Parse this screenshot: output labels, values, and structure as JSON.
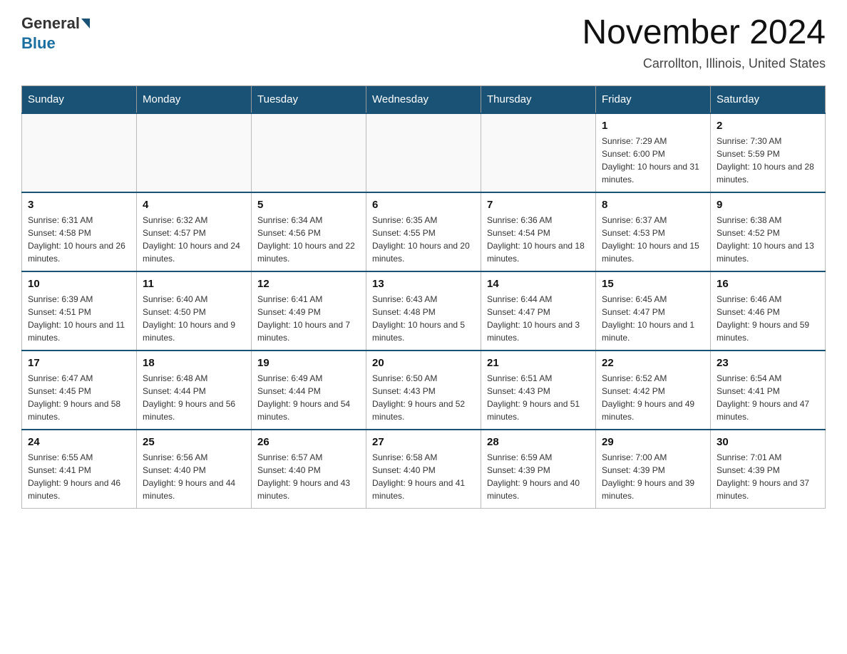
{
  "header": {
    "logo_general": "General",
    "logo_blue": "Blue",
    "title": "November 2024",
    "subtitle": "Carrollton, Illinois, United States"
  },
  "weekdays": [
    "Sunday",
    "Monday",
    "Tuesday",
    "Wednesday",
    "Thursday",
    "Friday",
    "Saturday"
  ],
  "weeks": [
    [
      {
        "day": "",
        "sunrise": "",
        "sunset": "",
        "daylight": ""
      },
      {
        "day": "",
        "sunrise": "",
        "sunset": "",
        "daylight": ""
      },
      {
        "day": "",
        "sunrise": "",
        "sunset": "",
        "daylight": ""
      },
      {
        "day": "",
        "sunrise": "",
        "sunset": "",
        "daylight": ""
      },
      {
        "day": "",
        "sunrise": "",
        "sunset": "",
        "daylight": ""
      },
      {
        "day": "1",
        "sunrise": "Sunrise: 7:29 AM",
        "sunset": "Sunset: 6:00 PM",
        "daylight": "Daylight: 10 hours and 31 minutes."
      },
      {
        "day": "2",
        "sunrise": "Sunrise: 7:30 AM",
        "sunset": "Sunset: 5:59 PM",
        "daylight": "Daylight: 10 hours and 28 minutes."
      }
    ],
    [
      {
        "day": "3",
        "sunrise": "Sunrise: 6:31 AM",
        "sunset": "Sunset: 4:58 PM",
        "daylight": "Daylight: 10 hours and 26 minutes."
      },
      {
        "day": "4",
        "sunrise": "Sunrise: 6:32 AM",
        "sunset": "Sunset: 4:57 PM",
        "daylight": "Daylight: 10 hours and 24 minutes."
      },
      {
        "day": "5",
        "sunrise": "Sunrise: 6:34 AM",
        "sunset": "Sunset: 4:56 PM",
        "daylight": "Daylight: 10 hours and 22 minutes."
      },
      {
        "day": "6",
        "sunrise": "Sunrise: 6:35 AM",
        "sunset": "Sunset: 4:55 PM",
        "daylight": "Daylight: 10 hours and 20 minutes."
      },
      {
        "day": "7",
        "sunrise": "Sunrise: 6:36 AM",
        "sunset": "Sunset: 4:54 PM",
        "daylight": "Daylight: 10 hours and 18 minutes."
      },
      {
        "day": "8",
        "sunrise": "Sunrise: 6:37 AM",
        "sunset": "Sunset: 4:53 PM",
        "daylight": "Daylight: 10 hours and 15 minutes."
      },
      {
        "day": "9",
        "sunrise": "Sunrise: 6:38 AM",
        "sunset": "Sunset: 4:52 PM",
        "daylight": "Daylight: 10 hours and 13 minutes."
      }
    ],
    [
      {
        "day": "10",
        "sunrise": "Sunrise: 6:39 AM",
        "sunset": "Sunset: 4:51 PM",
        "daylight": "Daylight: 10 hours and 11 minutes."
      },
      {
        "day": "11",
        "sunrise": "Sunrise: 6:40 AM",
        "sunset": "Sunset: 4:50 PM",
        "daylight": "Daylight: 10 hours and 9 minutes."
      },
      {
        "day": "12",
        "sunrise": "Sunrise: 6:41 AM",
        "sunset": "Sunset: 4:49 PM",
        "daylight": "Daylight: 10 hours and 7 minutes."
      },
      {
        "day": "13",
        "sunrise": "Sunrise: 6:43 AM",
        "sunset": "Sunset: 4:48 PM",
        "daylight": "Daylight: 10 hours and 5 minutes."
      },
      {
        "day": "14",
        "sunrise": "Sunrise: 6:44 AM",
        "sunset": "Sunset: 4:47 PM",
        "daylight": "Daylight: 10 hours and 3 minutes."
      },
      {
        "day": "15",
        "sunrise": "Sunrise: 6:45 AM",
        "sunset": "Sunset: 4:47 PM",
        "daylight": "Daylight: 10 hours and 1 minute."
      },
      {
        "day": "16",
        "sunrise": "Sunrise: 6:46 AM",
        "sunset": "Sunset: 4:46 PM",
        "daylight": "Daylight: 9 hours and 59 minutes."
      }
    ],
    [
      {
        "day": "17",
        "sunrise": "Sunrise: 6:47 AM",
        "sunset": "Sunset: 4:45 PM",
        "daylight": "Daylight: 9 hours and 58 minutes."
      },
      {
        "day": "18",
        "sunrise": "Sunrise: 6:48 AM",
        "sunset": "Sunset: 4:44 PM",
        "daylight": "Daylight: 9 hours and 56 minutes."
      },
      {
        "day": "19",
        "sunrise": "Sunrise: 6:49 AM",
        "sunset": "Sunset: 4:44 PM",
        "daylight": "Daylight: 9 hours and 54 minutes."
      },
      {
        "day": "20",
        "sunrise": "Sunrise: 6:50 AM",
        "sunset": "Sunset: 4:43 PM",
        "daylight": "Daylight: 9 hours and 52 minutes."
      },
      {
        "day": "21",
        "sunrise": "Sunrise: 6:51 AM",
        "sunset": "Sunset: 4:43 PM",
        "daylight": "Daylight: 9 hours and 51 minutes."
      },
      {
        "day": "22",
        "sunrise": "Sunrise: 6:52 AM",
        "sunset": "Sunset: 4:42 PM",
        "daylight": "Daylight: 9 hours and 49 minutes."
      },
      {
        "day": "23",
        "sunrise": "Sunrise: 6:54 AM",
        "sunset": "Sunset: 4:41 PM",
        "daylight": "Daylight: 9 hours and 47 minutes."
      }
    ],
    [
      {
        "day": "24",
        "sunrise": "Sunrise: 6:55 AM",
        "sunset": "Sunset: 4:41 PM",
        "daylight": "Daylight: 9 hours and 46 minutes."
      },
      {
        "day": "25",
        "sunrise": "Sunrise: 6:56 AM",
        "sunset": "Sunset: 4:40 PM",
        "daylight": "Daylight: 9 hours and 44 minutes."
      },
      {
        "day": "26",
        "sunrise": "Sunrise: 6:57 AM",
        "sunset": "Sunset: 4:40 PM",
        "daylight": "Daylight: 9 hours and 43 minutes."
      },
      {
        "day": "27",
        "sunrise": "Sunrise: 6:58 AM",
        "sunset": "Sunset: 4:40 PM",
        "daylight": "Daylight: 9 hours and 41 minutes."
      },
      {
        "day": "28",
        "sunrise": "Sunrise: 6:59 AM",
        "sunset": "Sunset: 4:39 PM",
        "daylight": "Daylight: 9 hours and 40 minutes."
      },
      {
        "day": "29",
        "sunrise": "Sunrise: 7:00 AM",
        "sunset": "Sunset: 4:39 PM",
        "daylight": "Daylight: 9 hours and 39 minutes."
      },
      {
        "day": "30",
        "sunrise": "Sunrise: 7:01 AM",
        "sunset": "Sunset: 4:39 PM",
        "daylight": "Daylight: 9 hours and 37 minutes."
      }
    ]
  ]
}
